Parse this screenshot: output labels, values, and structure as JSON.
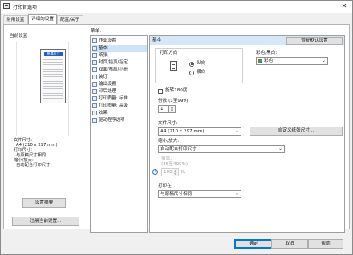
{
  "window": {
    "title": "打印首选项",
    "close_glyph": "✕"
  },
  "tabs": [
    "常用设置",
    "详细的设置",
    "配置/关于"
  ],
  "left": {
    "current_settings_label": "当前设置",
    "preview_header": "原稿尺寸",
    "info_lines": [
      "文件尺寸:",
      "A4 (210 x 297 mm)",
      "打印尺寸:",
      "与原稿尺寸相同",
      "缩小/放大:",
      "自动配合打印尺寸"
    ],
    "settings_summary_button": "设置摘要",
    "register_button": "注册当前设置..."
  },
  "tree": {
    "menu_label": "菜单:",
    "items": [
      "作业设置",
      "基本",
      "纸张",
      "封页/插页/指定",
      "双面/布局/小册",
      "装订",
      "输出设置",
      "印后处理",
      "打印质量: 标准",
      "打印质量: 高级",
      "效果",
      "驱动程序选项"
    ]
  },
  "basic": {
    "header_title": "基本",
    "restore_button": "恢复默认设置",
    "orientation_label": "打印方向",
    "portrait_label": "纵向",
    "landscape_label": "横向",
    "color_label": "彩色/黑白:",
    "color_value": "彩色",
    "rotate_label": "旋转180度",
    "copies_label": "份数:(1至999)",
    "copies_value": "1",
    "doc_size_label": "文件尺寸:",
    "doc_size_value": "A4 (210 x 297 mm)",
    "custom_paper_button": "自定义纸张尺寸...",
    "scale_label": "缩小/放大:",
    "scale_value": "自动配合打印尺寸",
    "ratio_label": "倍率:",
    "ratio_range": "(25至400%)",
    "ratio_value": "100",
    "ratio_unit": "%",
    "print_on_label": "打印在:",
    "print_on_value": "与原稿尺寸相同"
  },
  "footer": {
    "ok": "确定",
    "cancel": "取消",
    "help": "帮助"
  }
}
